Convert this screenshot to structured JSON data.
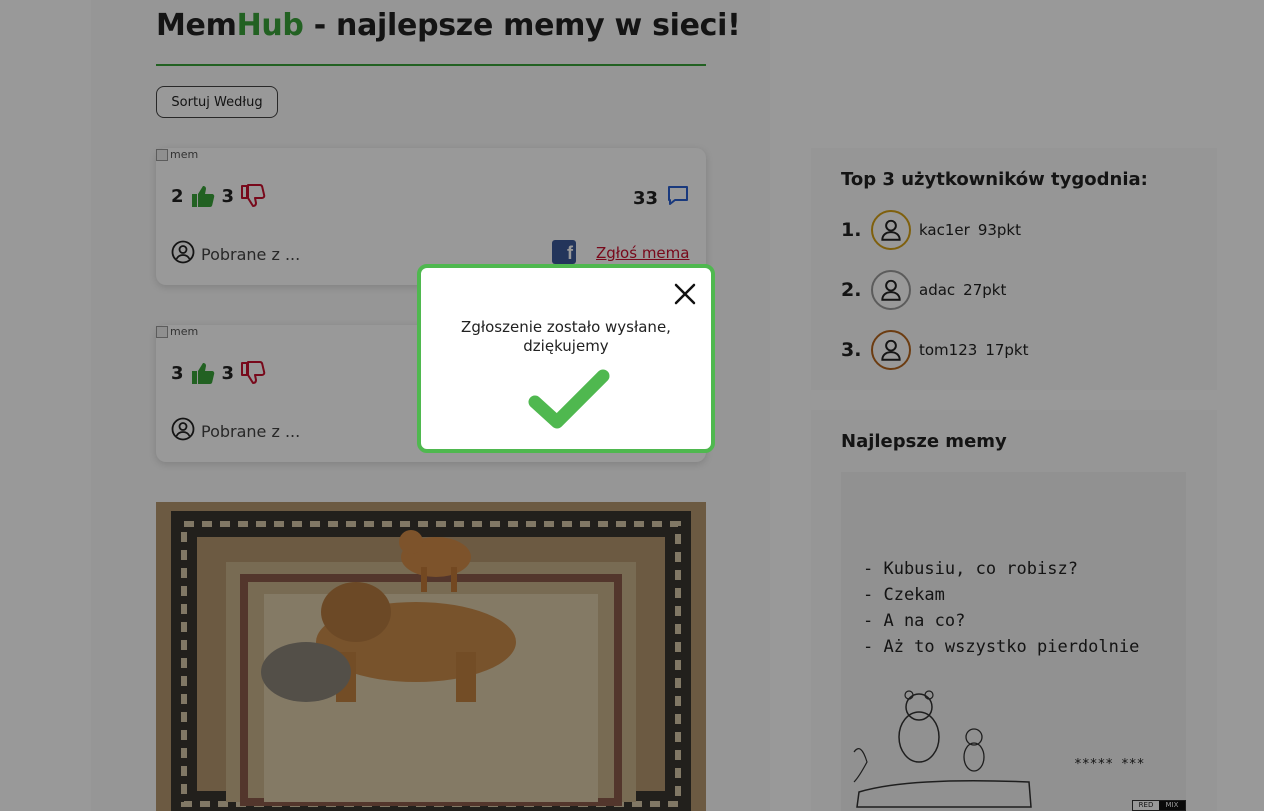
{
  "header": {
    "title_part1": "Mem",
    "title_part2": "Hub",
    "title_rest": " - najlepsze memy w sieci!",
    "sort_label": "Sortuj Według",
    "accent_color": "#3aa23a"
  },
  "posts": [
    {
      "img_alt": "mem",
      "likes": "2",
      "dislikes": "3",
      "comments": "33",
      "source": "Pobrane z ...",
      "report_label": "Zgłoś mema"
    },
    {
      "img_alt": "mem",
      "likes": "3",
      "dislikes": "3",
      "source": "Pobrane z ..."
    }
  ],
  "sidebar": {
    "top_title": "Top 3 użytkowników tygodnia:",
    "top_users": [
      {
        "rank": "1.",
        "name": "kac1er",
        "points": "93pkt",
        "ring_color": "#d4a017"
      },
      {
        "rank": "2.",
        "name": "adac",
        "points": "27pkt",
        "ring_color": "#9a9a9a"
      },
      {
        "rank": "3.",
        "name": "tom123",
        "points": "17pkt",
        "ring_color": "#b5651d"
      }
    ],
    "best_title": "Najlepsze memy",
    "best_meme_lines": [
      "- Kubusiu, co robisz?",
      "- Czekam",
      "- A na co?",
      "- Aż to wszystko pierdolnie"
    ],
    "best_meme_stars": "***** ***",
    "best_meme_badge_left": "RED",
    "best_meme_badge_right": "MIX"
  },
  "modal": {
    "line1": "Zgłoszenie zostało wysłane,",
    "line2": "dziękujemy",
    "border_color": "#4fb84f",
    "check_color": "#4fb84f"
  }
}
